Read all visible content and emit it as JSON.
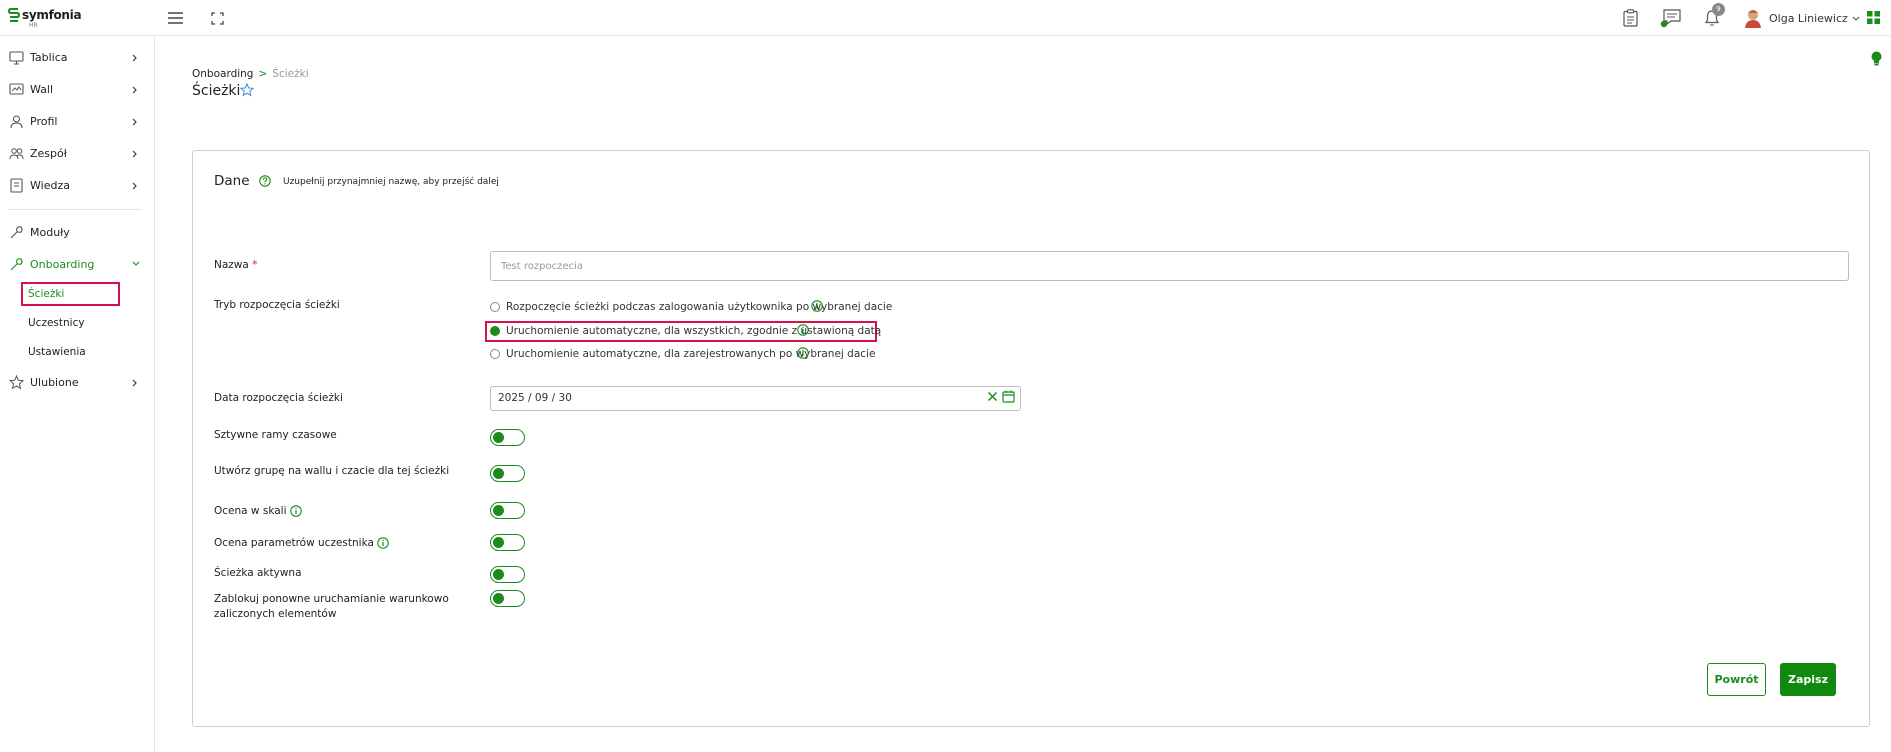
{
  "app": {
    "logo_text": "symfonia",
    "logo_sub": "HR",
    "brand_color": "#1d8a1d",
    "highlight_color": "#d6114a"
  },
  "topbar": {
    "notification_count": "9",
    "user_name": "Olga Liniewicz"
  },
  "sidebar": {
    "items": [
      {
        "label": "Tablica",
        "icon": "monitor-icon"
      },
      {
        "label": "Wall",
        "icon": "wall-icon"
      },
      {
        "label": "Profil",
        "icon": "person-icon"
      },
      {
        "label": "Zespół",
        "icon": "team-icon"
      },
      {
        "label": "Wiedza",
        "icon": "book-icon"
      },
      {
        "label": "Moduły",
        "icon": "wrench-icon"
      },
      {
        "label": "Onboarding",
        "icon": "wrench-icon"
      },
      {
        "label": "Ulubione",
        "icon": "star-icon"
      }
    ],
    "subitems": [
      {
        "label": "Ścieżki"
      },
      {
        "label": "Uczestnicy"
      },
      {
        "label": "Ustawienia"
      }
    ]
  },
  "breadcrumb": {
    "parent": "Onboarding",
    "separator": ">",
    "current": "Ścieżki"
  },
  "page": {
    "title": "Ścieżki"
  },
  "form": {
    "section_title": "Dane",
    "section_hint": "Uzupełnij przynajmniej nazwę, aby przejść dalej",
    "name_label": "Nazwa",
    "name_required_mark": "*",
    "name_value": "",
    "name_placeholder": "Test rozpoczecia",
    "mode_label": "Tryb rozpoczęcia ścieżki",
    "mode_options": [
      {
        "label": "Rozpoczęcie ścieżki podczas zalogowania użytkownika po wybranej dacie",
        "checked": false
      },
      {
        "label": "Uruchomienie automatyczne, dla wszystkich, zgodnie z ustawioną datą",
        "checked": true
      },
      {
        "label": "Uruchomienie automatyczne, dla zarejestrowanych po wybranej dacie",
        "checked": false
      }
    ],
    "date_label": "Data rozpoczęcia ścieżki",
    "date_value": "2025 / 09 / 30",
    "toggles": [
      {
        "label": "Sztywne ramy czasowe",
        "on": false
      },
      {
        "label": "Utwórz grupę na wallu i czacie dla tej ścieżki",
        "on": false
      },
      {
        "label": "Ocena w skali",
        "on": false
      },
      {
        "label": "Ocena parametrów uczestnika",
        "on": false
      },
      {
        "label": "Ścieżka aktywna",
        "on": false
      },
      {
        "label": "Zablokuj ponowne uruchamianie warunkowo zaliczonych elementów",
        "on": false
      }
    ]
  },
  "buttons": {
    "back": "Powrót",
    "save": "Zapisz"
  }
}
